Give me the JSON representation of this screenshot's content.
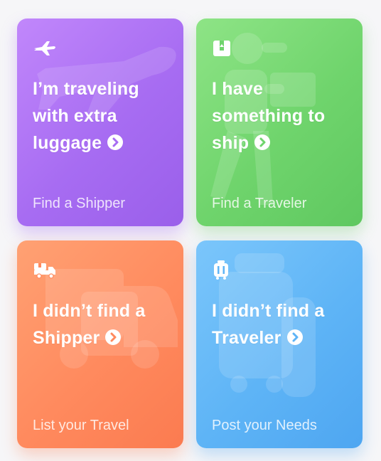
{
  "cards": [
    {
      "headline": [
        "I’m traveling",
        "with extra",
        "luggage"
      ],
      "subtitle": "Find a Shipper",
      "icon": "airplane-icon",
      "color": "#a76cf2"
    },
    {
      "headline": [
        "I have",
        "something to",
        "ship"
      ],
      "subtitle": "Find a Traveler",
      "icon": "package-icon",
      "color": "#6fd46c"
    },
    {
      "headline": [
        "I didn’t find a",
        "Shipper"
      ],
      "subtitle": "List your Travel",
      "icon": "delivery-truck-icon",
      "color": "#ff8a5e"
    },
    {
      "headline": [
        "I didn’t find a",
        "Traveler"
      ],
      "subtitle": "Post your Needs",
      "icon": "suitcase-icon",
      "color": "#5eb4f6"
    }
  ]
}
